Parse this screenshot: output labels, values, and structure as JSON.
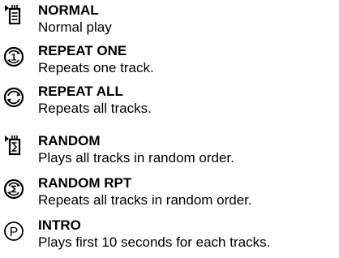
{
  "modes": [
    {
      "icon": "normal-play-icon",
      "title": "NORMAL",
      "description": "Normal play"
    },
    {
      "icon": "repeat-one-icon",
      "title": "REPEAT ONE",
      "description": "Repeats one track."
    },
    {
      "icon": "repeat-all-icon",
      "title": "REPEAT ALL",
      "description": "Repeats all tracks."
    },
    {
      "icon": "random-icon",
      "title": "RANDOM",
      "description": "Plays all tracks in random order."
    },
    {
      "icon": "random-repeat-icon",
      "title": "RANDOM RPT",
      "description": "Repeats all tracks in random order."
    },
    {
      "icon": "intro-icon",
      "title": "INTRO",
      "description": "Plays first 10 seconds for each tracks."
    }
  ],
  "icon_glyphs": {
    "repeat_one": "1",
    "intro": "P"
  }
}
